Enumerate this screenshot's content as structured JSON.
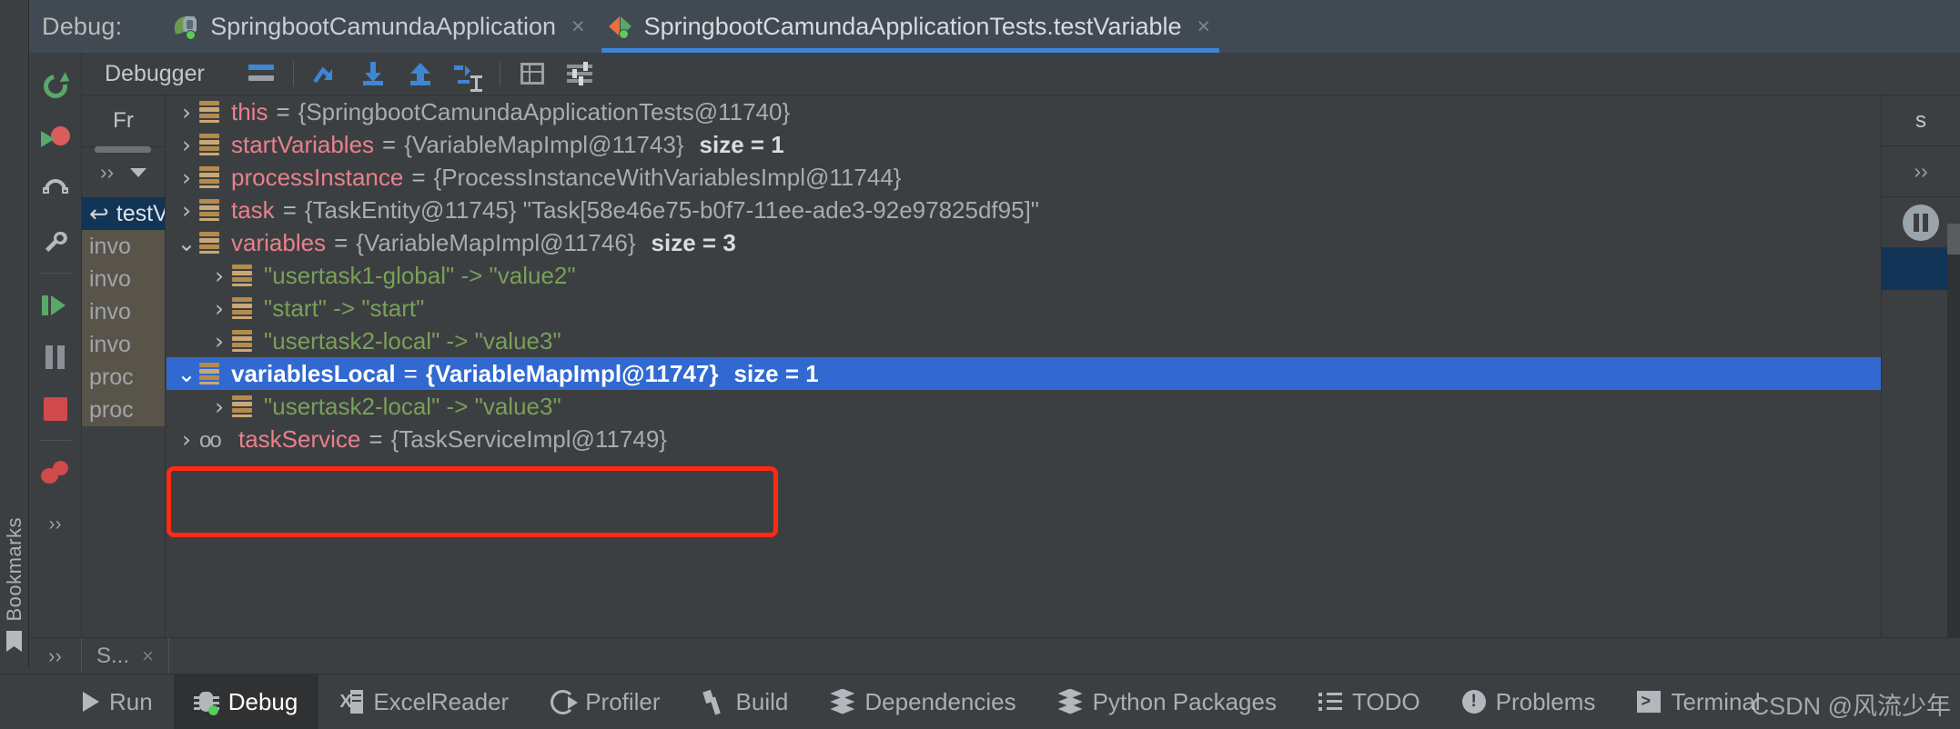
{
  "window": {
    "debug_label": "Debug:"
  },
  "tabs": [
    {
      "title": "SpringbootCamundaApplication",
      "icon": "spring-leaf-icon",
      "close": "×",
      "active": false
    },
    {
      "title": "SpringbootCamundaApplicationTests.testVariable",
      "icon": "junit-run-icon",
      "close": "×",
      "active": true
    }
  ],
  "left_rail": {
    "bookmarks_label": "Bookmarks",
    "flag_icon": "bookmark-flag-icon"
  },
  "debug_rail": {
    "buttons": [
      {
        "name": "rerun-icon"
      },
      {
        "name": "debug-rerun-icon"
      },
      {
        "name": "update-running-application-icon"
      },
      {
        "name": "settings-wrench-icon"
      },
      {
        "name": "resume-program-icon"
      },
      {
        "name": "pause-program-icon"
      },
      {
        "name": "stop-icon"
      },
      {
        "name": "mute-breakpoints-icon"
      }
    ],
    "more_label": "››"
  },
  "toolbar": {
    "title": "Debugger",
    "buttons": [
      {
        "name": "layout-settings-icon"
      },
      {
        "name": "step-over-icon"
      },
      {
        "name": "step-into-icon"
      },
      {
        "name": "step-out-icon"
      },
      {
        "name": "run-to-cursor-icon"
      },
      {
        "name": "evaluate-expression-icon"
      },
      {
        "name": "debugger-settings-icon"
      }
    ]
  },
  "frames": {
    "header": "Fr",
    "more": "››",
    "rows": [
      {
        "label": "testV",
        "selected": true,
        "icon": "return-arrow-icon"
      },
      {
        "label": "invo",
        "selected": false,
        "marked": true
      },
      {
        "label": "invo",
        "selected": false,
        "marked": true
      },
      {
        "label": "invo",
        "selected": false,
        "marked": true
      },
      {
        "label": "invo",
        "selected": false,
        "marked": true
      },
      {
        "label": "proc",
        "selected": false,
        "marked": true
      },
      {
        "label": "proc",
        "selected": false,
        "marked": true
      }
    ]
  },
  "variables": [
    {
      "twisty": "›",
      "indent": 0,
      "icon": "field-icon",
      "name": "this",
      "eq": "=",
      "value": "{SpringbootCamundaApplicationTests@11740}",
      "size": "",
      "selected": false,
      "kind": "field"
    },
    {
      "twisty": "›",
      "indent": 0,
      "icon": "field-icon",
      "name": "startVariables",
      "eq": "=",
      "value": "{VariableMapImpl@11743}",
      "size": "size = 1",
      "selected": false,
      "kind": "field"
    },
    {
      "twisty": "›",
      "indent": 0,
      "icon": "field-icon",
      "name": "processInstance",
      "eq": "=",
      "value": "{ProcessInstanceWithVariablesImpl@11744}",
      "size": "",
      "selected": false,
      "kind": "field"
    },
    {
      "twisty": "›",
      "indent": 0,
      "icon": "field-icon",
      "name": "task",
      "eq": "=",
      "value": "{TaskEntity@11745} \"Task[58e46e75-b0f7-11ee-ade3-92e97825df95]\"",
      "size": "",
      "selected": false,
      "kind": "field"
    },
    {
      "twisty": "⌄",
      "indent": 0,
      "icon": "field-icon",
      "name": "variables",
      "eq": "=",
      "value": "{VariableMapImpl@11746}",
      "size": "size = 3",
      "selected": false,
      "kind": "field"
    },
    {
      "twisty": "›",
      "indent": 1,
      "icon": "map-entry-icon",
      "name": "",
      "eq": "",
      "value": "\"usertask1-global\" -> \"value2\"",
      "size": "",
      "selected": false,
      "kind": "entry"
    },
    {
      "twisty": "›",
      "indent": 1,
      "icon": "map-entry-icon",
      "name": "",
      "eq": "",
      "value": "\"start\" -> \"start\"",
      "size": "",
      "selected": false,
      "kind": "entry"
    },
    {
      "twisty": "›",
      "indent": 1,
      "icon": "map-entry-icon",
      "name": "",
      "eq": "",
      "value": "\"usertask2-local\" -> \"value3\"",
      "size": "",
      "selected": false,
      "kind": "entry"
    },
    {
      "twisty": "⌄",
      "indent": 0,
      "icon": "field-icon",
      "name": "variablesLocal",
      "eq": "=",
      "value": "{VariableMapImpl@11747}",
      "size": "size = 1",
      "selected": true,
      "kind": "field"
    },
    {
      "twisty": "›",
      "indent": 1,
      "icon": "map-entry-icon",
      "name": "",
      "eq": "",
      "value": "\"usertask2-local\" -> \"value3\"",
      "size": "",
      "selected": false,
      "kind": "entry"
    },
    {
      "twisty": "›",
      "indent": 0,
      "icon": "interface-icon",
      "name": "taskService",
      "eq": "=",
      "value": "{TaskServiceImpl@11749}",
      "size": "",
      "selected": false,
      "kind": "interface"
    }
  ],
  "right_rail": {
    "label": "s",
    "more": "››",
    "pause_icon": "pause-icon"
  },
  "tool_strip": {
    "chev": "››",
    "tabs": [
      {
        "label": "S...",
        "close": "×"
      }
    ]
  },
  "status_bar": {
    "items": [
      {
        "label": "Run",
        "icon": "run-play-icon",
        "active": false
      },
      {
        "label": "Debug",
        "icon": "debug-bug-icon",
        "active": true
      },
      {
        "label": "ExcelReader",
        "icon": "excel-icon",
        "active": false
      },
      {
        "label": "Profiler",
        "icon": "profiler-icon",
        "active": false
      },
      {
        "label": "Build",
        "icon": "build-hammer-icon",
        "active": false
      },
      {
        "label": "Dependencies",
        "icon": "dependencies-layers-icon",
        "active": false
      },
      {
        "label": "Python Packages",
        "icon": "python-packages-layers-icon",
        "active": false
      },
      {
        "label": "TODO",
        "icon": "todo-list-icon",
        "active": false
      },
      {
        "label": "Problems",
        "icon": "problems-warning-icon",
        "active": false
      },
      {
        "label": "Terminal",
        "icon": "terminal-icon",
        "active": false
      }
    ]
  },
  "watermark": {
    "text": "CSDN @风流少年"
  },
  "colors": {
    "accent_blue": "#3169d0",
    "tab_underline": "#3e86d6",
    "annotation_red": "#ff2a14",
    "var_name": "#e8808d",
    "string_green": "#78a05a",
    "panel_bg": "#3c3f41"
  }
}
